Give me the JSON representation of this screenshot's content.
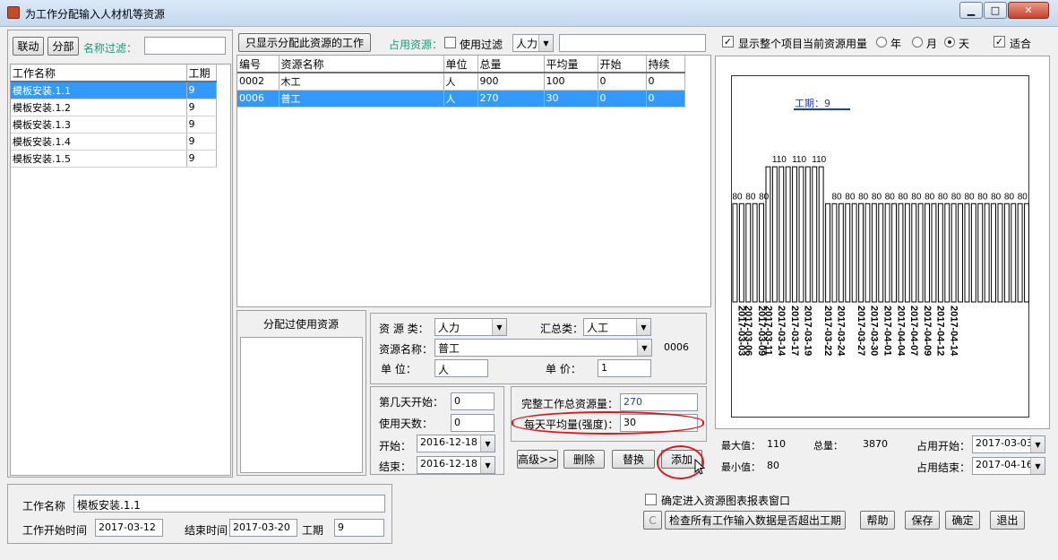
{
  "window": {
    "title": "为工作分配输入人材机等资源",
    "min": "▁",
    "max": "□",
    "close": "✕"
  },
  "left": {
    "link_btn": "联动",
    "split_btn": "分部",
    "filter_label": "名称过滤：",
    "filter_value": "",
    "headers": [
      "工作名称",
      "工期"
    ],
    "rows": [
      {
        "name": "模板安装.1.1",
        "dur": "9"
      },
      {
        "name": "模板安装.1.2",
        "dur": "9"
      },
      {
        "name": "模板安装.1.3",
        "dur": "9"
      },
      {
        "name": "模板安装.1.4",
        "dur": "9"
      },
      {
        "name": "模板安装.1.5",
        "dur": "9"
      }
    ]
  },
  "middle": {
    "only_show_btn": "只显示分配此资源的工作",
    "occupy_label": "占用资源：",
    "use_filter_label": "使用过滤",
    "type_select": "人力",
    "search_value": "",
    "headers": [
      "编号",
      "资源名称",
      "单位",
      "总量",
      "平均量",
      "开始",
      "持续"
    ],
    "rows": [
      {
        "id": "0002",
        "name": "木工",
        "unit": "人",
        "total": "900",
        "avg": "100",
        "start": "0",
        "dur": "0"
      },
      {
        "id": "0006",
        "name": "普工",
        "unit": "人",
        "total": "270",
        "avg": "30",
        "start": "0",
        "dur": "0"
      }
    ],
    "assigned_title": "分配过使用资源"
  },
  "form": {
    "res_type_label": "资 源 类：",
    "res_type": "人力",
    "sum_type_label": "汇总类：",
    "sum_type": "人工",
    "res_name_label": "资源名称：",
    "res_name": "普工",
    "res_code": "0006",
    "unit_label": "单   位：",
    "unit": "人",
    "price_label": "单   价：",
    "price": "1",
    "day_start_label": "第几天开始：",
    "day_start": "0",
    "use_days_label": "使用天数：",
    "use_days": "0",
    "start_label": "开始：",
    "start": "2016-12-18",
    "end_label": "结束：",
    "end": "2016-12-18",
    "total_label": "完整工作总资源量：",
    "total": "270",
    "avg_label": "每天平均量(强度)：",
    "avg": "30",
    "adv_btn": "高级>>",
    "del_btn": "删除",
    "replace_btn": "替换",
    "add_btn": "添加"
  },
  "right": {
    "show_total_label": "显示整个项目当前资源用量",
    "year_label": "年",
    "month_label": "月",
    "day_label": "天",
    "fit_label": "适合",
    "period_label": "工期：9",
    "max_label": "最大值：",
    "max": "110",
    "total_label": "总量：",
    "total": "3870",
    "min_label": "最小值：",
    "min": "80",
    "occ_start_label": "占用开始：",
    "occ_start": "2017-03-03",
    "occ_end_label": "占用结束：",
    "occ_end": "2017-04-16"
  },
  "chart_data": {
    "type": "bar",
    "ylim": [
      0,
      140
    ],
    "values": [
      80,
      80,
      80,
      80,
      80,
      110,
      110,
      110,
      110,
      110,
      110,
      110,
      110,
      110,
      80,
      80,
      80,
      80,
      80,
      80,
      80,
      80,
      80,
      80,
      80,
      80,
      80,
      80,
      80,
      80,
      80,
      80,
      80,
      80,
      80,
      80,
      80,
      80,
      80,
      80,
      80,
      80,
      80,
      80,
      80
    ],
    "value_labels": [
      {
        "bar": 0,
        "text": "80"
      },
      {
        "bar": 2,
        "text": "80"
      },
      {
        "bar": 4,
        "text": "80"
      },
      {
        "bar": 6,
        "text": "110"
      },
      {
        "bar": 9,
        "text": "110"
      },
      {
        "bar": 12,
        "text": "110"
      },
      {
        "bar": 15,
        "text": "80"
      },
      {
        "bar": 17,
        "text": "80"
      },
      {
        "bar": 19,
        "text": "80"
      },
      {
        "bar": 21,
        "text": "80"
      },
      {
        "bar": 23,
        "text": "80"
      },
      {
        "bar": 25,
        "text": "80"
      },
      {
        "bar": 27,
        "text": "80"
      },
      {
        "bar": 29,
        "text": "80"
      },
      {
        "bar": 31,
        "text": "80"
      },
      {
        "bar": 33,
        "text": "80"
      },
      {
        "bar": 35,
        "text": "80"
      },
      {
        "bar": 37,
        "text": "80"
      },
      {
        "bar": 39,
        "text": "80"
      },
      {
        "bar": 41,
        "text": "80"
      },
      {
        "bar": 43,
        "text": "80"
      }
    ],
    "tick_labels": [
      {
        "bar": 0,
        "text": "2017-03-03"
      },
      {
        "bar": 1,
        "text": "2017-03-06"
      },
      {
        "bar": 3,
        "text": "2017-03-09"
      },
      {
        "bar": 4,
        "text": "2017-03-11"
      },
      {
        "bar": 6,
        "text": "2017-03-14"
      },
      {
        "bar": 8,
        "text": "2017-03-17"
      },
      {
        "bar": 10,
        "text": "2017-03-19"
      },
      {
        "bar": 13,
        "text": "2017-03-22"
      },
      {
        "bar": 15,
        "text": "2017-03-24"
      },
      {
        "bar": 18,
        "text": "2017-03-27"
      },
      {
        "bar": 20,
        "text": "2017-03-30"
      },
      {
        "bar": 22,
        "text": "2017-04-01"
      },
      {
        "bar": 24,
        "text": "2017-04-04"
      },
      {
        "bar": 26,
        "text": "2017-04-07"
      },
      {
        "bar": 28,
        "text": "2017-04-09"
      },
      {
        "bar": 30,
        "text": "2017-04-12"
      },
      {
        "bar": 32,
        "text": "2017-04-14"
      }
    ]
  },
  "bottom": {
    "work_name_label": "工作名称",
    "work_name": "模板安装.1.1",
    "work_start_label": "工作开始时间",
    "work_start": "2017-03-12",
    "end_label": "结束时间",
    "end": "2017-03-20",
    "dur_label": "工期",
    "dur": "9",
    "confirm_chart_label": "确定进入资源图表报表窗口",
    "c_btn": "C",
    "check_btn": "检查所有工作输入数据是否超出工期",
    "help_btn": "帮助",
    "save_btn": "保存",
    "ok_btn": "确定",
    "exit_btn": "退出"
  }
}
